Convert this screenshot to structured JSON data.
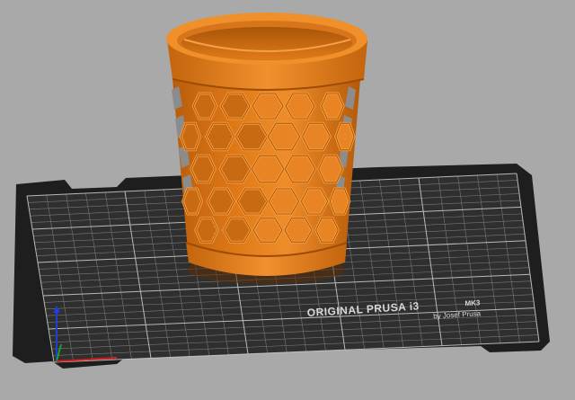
{
  "viewport": {
    "background_color": "#a9a9a9",
    "bed": {
      "brand_line1": "ORIGINAL PRUSA i3",
      "brand_line1_suffix": "MK3",
      "brand_line2": "by Josef Prusa",
      "plate_color": "#2f2f2f",
      "frame_color": "#1f1f1f",
      "grid_color": "#8a8a8a"
    },
    "model": {
      "name": "honeycomb-vase",
      "color": "#e07a18",
      "shadow_color": "#b35a08",
      "highlight_color": "#f49a3c"
    },
    "axes": {
      "x_color": "#d22020",
      "y_color": "#1aa31a",
      "z_color": "#1f3fd6"
    }
  }
}
